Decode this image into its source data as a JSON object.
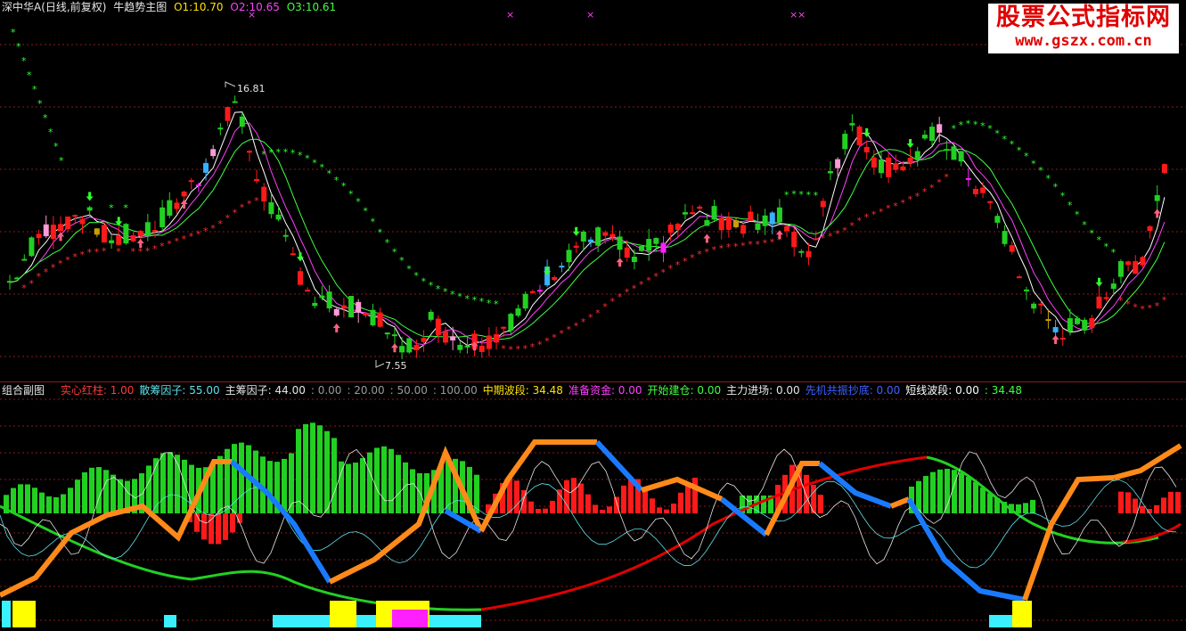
{
  "main_chart": {
    "title": "深中华A(日线,前复权)",
    "indicator": "牛趋势主图",
    "o1_label": "O1:",
    "o1_value": "10.70",
    "o2_label": "O2:",
    "o2_value": "10.65",
    "o3_label": "O3:",
    "o3_value": "10.61",
    "high_label": "16.81",
    "low_label": "7.55"
  },
  "watermark": {
    "line1": "股票公式指标网",
    "line2": "www.gszx.com.cn"
  },
  "sub_chart": {
    "title": "组合副图",
    "items": [
      {
        "label": "实心红柱:",
        "value": "1.00",
        "color": "#ff3b3b"
      },
      {
        "label": "散筹因子:",
        "value": "55.00",
        "color": "#5fe0e8"
      },
      {
        "label": "主筹因子:",
        "value": "44.00",
        "color": "#e6e6e6"
      },
      {
        "label": ":",
        "value": "0.00",
        "color": "#9a9a9a"
      },
      {
        "label": ":",
        "value": "20.00",
        "color": "#9a9a9a"
      },
      {
        "label": ":",
        "value": "50.00",
        "color": "#9a9a9a"
      },
      {
        "label": ":",
        "value": "100.00",
        "color": "#9a9a9a"
      },
      {
        "label": "中期波段:",
        "value": "34.48",
        "color": "#ffe000"
      },
      {
        "label": "准备资金:",
        "value": "0.00",
        "color": "#ff40ff"
      },
      {
        "label": "开始建仓:",
        "value": "0.00",
        "color": "#40ff40"
      },
      {
        "label": "主力进场:",
        "value": "0.00",
        "color": "#e6e6e6"
      },
      {
        "label": "先机共振抄底:",
        "value": "0.00",
        "color": "#4060ff"
      },
      {
        "label": "短线波段:",
        "value": "0.00",
        "color": "#ffffff"
      },
      {
        "label": ":",
        "value": "34.48",
        "color": "#40ff40"
      }
    ]
  },
  "colors": {
    "up": "#ff1a1a",
    "down": "#22d022",
    "grid": "#8a1a1a",
    "pink": "#ff9ad8",
    "cyan": "#38b0ff",
    "magenta": "#ff20ff",
    "gold": "#c8a000"
  }
}
